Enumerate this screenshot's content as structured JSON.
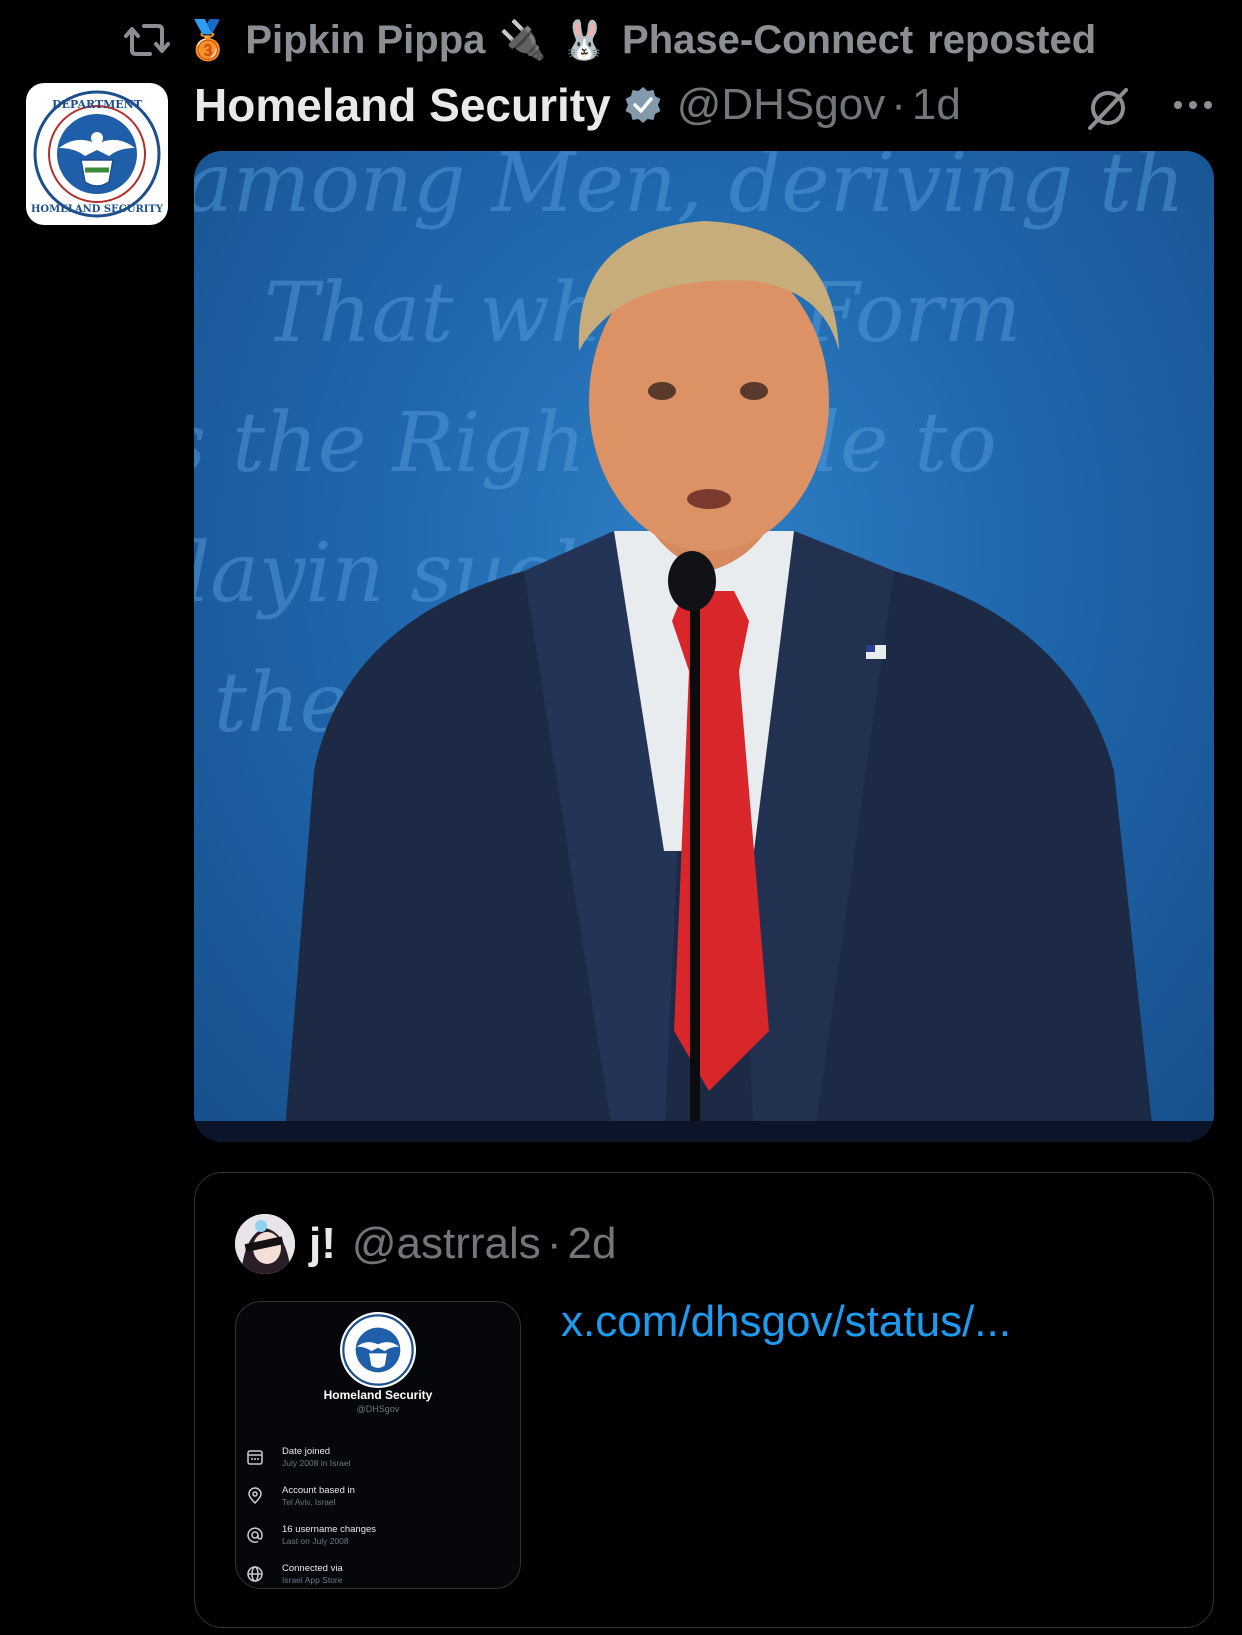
{
  "repost": {
    "icon": "repost-icon",
    "medal": "🥉",
    "user_name": "Pipkin Pippa",
    "emoji_plug": "🔌",
    "emoji_rabbit": "🐰",
    "user_suffix": "Phase-Connect",
    "action": "reposted"
  },
  "post": {
    "display_name": "Homeland Security",
    "verified_icon": "verified-badge-icon",
    "handle": "@DHSgov",
    "separator": "·",
    "time": "1d",
    "avatar_icon": "dhs-seal-icon",
    "grok_icon": "grok-icon",
    "more_icon": "more-icon"
  },
  "media": {
    "backdrop_text": [
      "among Men, deriving th",
      "That wh        any Form",
      "s the Righ       People to",
      "layin            such",
      "the               kely"
    ]
  },
  "quote": {
    "display_name": "j!",
    "handle": "@astrrals",
    "separator": "·",
    "time": "2d",
    "link_text": "x.com/dhsgov/status/...",
    "thumbnail": {
      "name": "Homeland Security",
      "handle": "@DHSgov",
      "rows": [
        {
          "icon": "calendar-icon",
          "label": "Date joined",
          "sub": "July 2008 in Israel"
        },
        {
          "icon": "location-pin-icon",
          "label": "Account based in",
          "sub": "Tel Aviv, Israel"
        },
        {
          "icon": "at-sign-icon",
          "label": "16 username changes",
          "sub": "Last on July 2008"
        },
        {
          "icon": "globe-icon",
          "label": "Connected via",
          "sub": "Israel App Store"
        }
      ]
    }
  },
  "colors": {
    "background": "#000000",
    "text_primary": "#e7e9ea",
    "text_secondary": "#71767b",
    "link": "#1d9bf0",
    "verified": "#829aab",
    "border": "#2f3336"
  }
}
